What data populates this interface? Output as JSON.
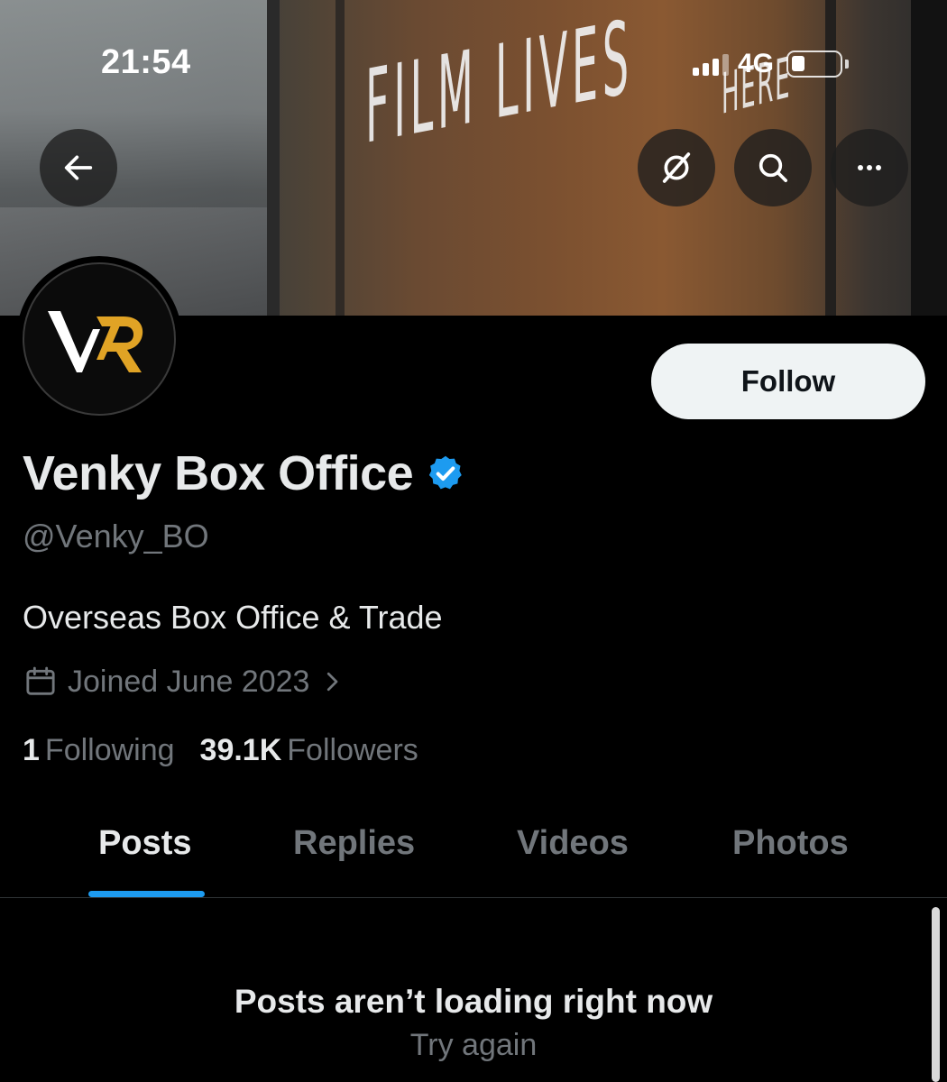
{
  "status_bar": {
    "time": "21:54",
    "network": "4G"
  },
  "banner": {
    "sign_text": "FILM LIVES",
    "sign_text_small": "HERE"
  },
  "header_icons": [
    "back-arrow-icon",
    "translate-off-icon",
    "search-icon",
    "more-icon"
  ],
  "profile": {
    "display_name": "Venky Box Office",
    "verified": true,
    "handle": "@Venky_BO",
    "bio": "Overseas Box Office & Trade",
    "joined": "Joined June 2023",
    "following_count": "1",
    "following_label": "Following",
    "followers_count": "39.1K",
    "followers_label": "Followers",
    "follow_button_label": "Follow"
  },
  "tabs": [
    {
      "label": "Posts",
      "active": true
    },
    {
      "label": "Replies",
      "active": false
    },
    {
      "label": "Videos",
      "active": false
    },
    {
      "label": "Photos",
      "active": false
    }
  ],
  "feed": {
    "error_title": "Posts aren’t loading right now",
    "retry_label": "Try again"
  },
  "colors": {
    "accent": "#1d9bf0",
    "avatar_gold": "#e0a325",
    "muted_text": "#71767b",
    "primary_text": "#e7e9ea"
  }
}
